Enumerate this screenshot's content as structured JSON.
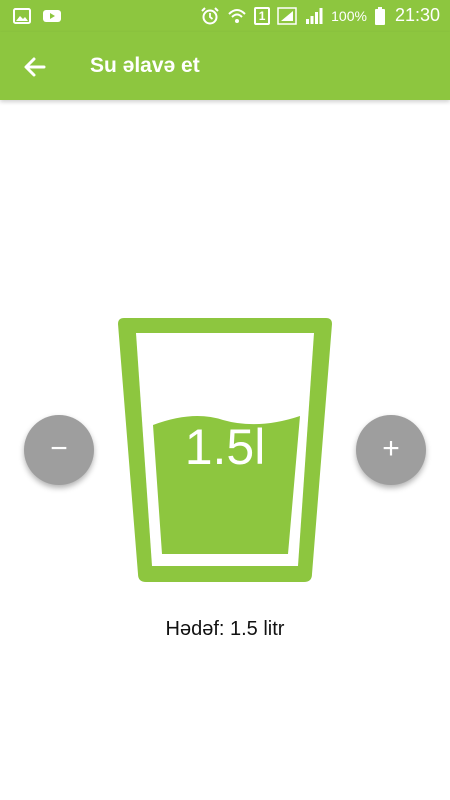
{
  "colors": {
    "accent": "#8dc63f",
    "button_gray": "#9e9e9e"
  },
  "status_bar": {
    "left_icons": [
      "gallery-icon",
      "youtube-icon"
    ],
    "right_icons": [
      "alarm-icon",
      "wifi-icon",
      "sim-icon",
      "signal-icon",
      "signal-icon",
      "battery-icon"
    ],
    "sim_number": "1",
    "battery": "100%",
    "time": "21:30"
  },
  "app_bar": {
    "back_icon": "arrow-back-icon",
    "title": "Su əlavə et"
  },
  "glass": {
    "amount": "1.5l",
    "fill_level": 0.58
  },
  "controls": {
    "minus_label": "−",
    "plus_label": "+"
  },
  "goal_text": "Hədəf: 1.5 litr"
}
